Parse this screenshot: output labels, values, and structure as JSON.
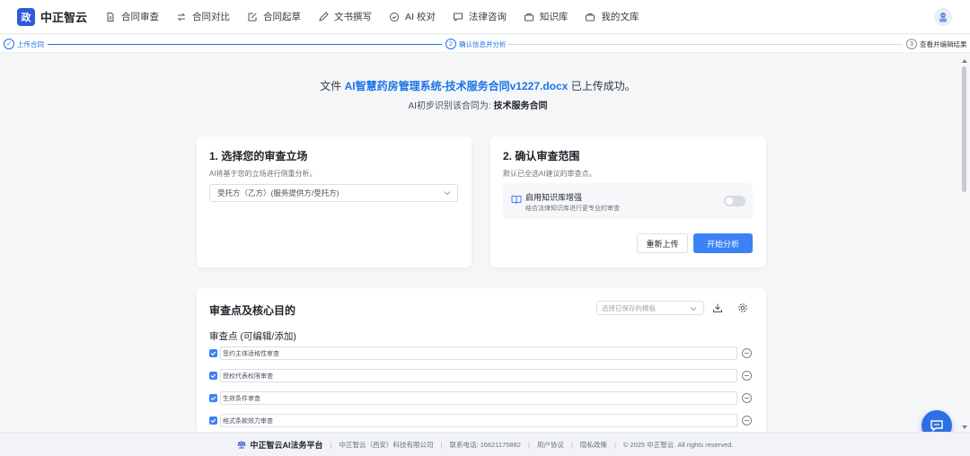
{
  "nav": {
    "logo_char": "政",
    "brand": "中正智云",
    "items": [
      {
        "label": "合同审查",
        "icon": "document-icon"
      },
      {
        "label": "合同对比",
        "icon": "swap-icon"
      },
      {
        "label": "合同起草",
        "icon": "edit-icon"
      },
      {
        "label": "文书撰写",
        "icon": "pen-icon"
      },
      {
        "label": "AI 校对",
        "icon": "check-circle-icon"
      },
      {
        "label": "法律咨询",
        "icon": "chat-icon"
      },
      {
        "label": "知识库",
        "icon": "briefcase-icon"
      },
      {
        "label": "我的文库",
        "icon": "briefcase-icon"
      }
    ]
  },
  "stepper": {
    "step1": {
      "num": "✓",
      "label": "上传合同"
    },
    "step2": {
      "num": "2",
      "label": "确认信息并分析"
    },
    "step3": {
      "num": "3",
      "label": "查看并编辑结果"
    }
  },
  "message": {
    "prefix": "文件",
    "filename": "AI智慧药房管理系统-技术服务合同v1227.docx",
    "suffix": "已上传成功。",
    "type_prefix": "AI初步识别该合同为:",
    "type_value": "技术服务合同"
  },
  "stance": {
    "title": "1. 选择您的审查立场",
    "subtitle": "AI将基于您的立场进行侧重分析。",
    "selected": "受托方（乙方）(服务提供方/受托方)"
  },
  "scope": {
    "title": "2. 确认审查范围",
    "subtitle": "默认已全选AI建议的审查点。",
    "kb_title": "启用知识库增强",
    "kb_desc": "结合法律知识库进行更专业的审查",
    "kb_enabled": false,
    "reupload_label": "重新上传",
    "start_label": "开始分析"
  },
  "review": {
    "title": "审查点及核心目的",
    "template_placeholder": "选择已保存的模板",
    "subtitle": "审查点 (可编辑/添加)",
    "points": [
      {
        "label": "签约主体适格性审查",
        "checked": true
      },
      {
        "label": "授权代表权限审查",
        "checked": true
      },
      {
        "label": "生效条件审查",
        "checked": true
      },
      {
        "label": "格式条款效力审查",
        "checked": true
      }
    ]
  },
  "footer": {
    "brand": "中正智云AI法务平台",
    "company": "中正智云（西安）科技有限公司",
    "phone": "联系电话: 16621175882",
    "terms": "用户协议",
    "privacy": "隐私政策",
    "copyright": "© 2025 中正智云. All rights reserved."
  },
  "colors": {
    "primary": "#3b82f6",
    "brand": "#2c5bdb",
    "link": "#1a73e8"
  }
}
